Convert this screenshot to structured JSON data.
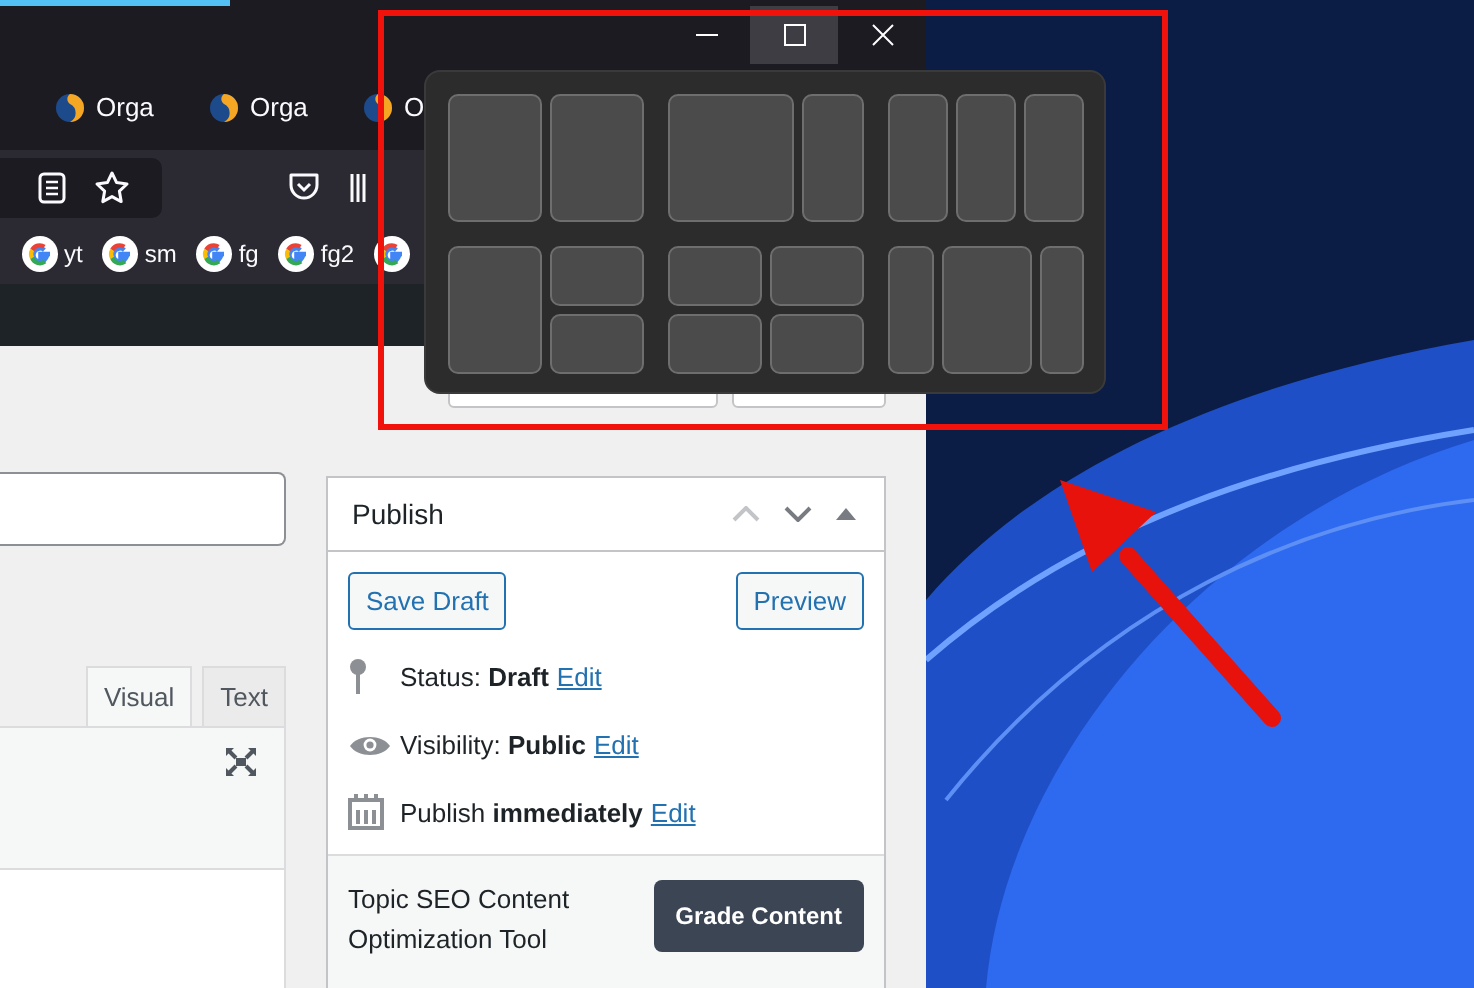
{
  "window_buttons": [
    {
      "kind": "minimize",
      "hovered": false
    },
    {
      "kind": "maximize",
      "hovered": true
    },
    {
      "kind": "close",
      "hovered": false
    }
  ],
  "tabs": [
    {
      "label": "Orga"
    },
    {
      "label": "Orga"
    },
    {
      "label": "O"
    }
  ],
  "bookmarks": [
    {
      "kind": "google",
      "label": "yt"
    },
    {
      "kind": "google",
      "label": "sm"
    },
    {
      "kind": "google",
      "label": "fg"
    },
    {
      "kind": "google",
      "label": "fg2"
    },
    {
      "kind": "google"
    }
  ],
  "editor_tabs": [
    {
      "label": "Visual",
      "selected": true
    },
    {
      "label": "Text",
      "selected": false
    }
  ],
  "publish": {
    "title": "Publish",
    "save_button": "Save Draft",
    "preview_button": "Preview",
    "lines": [
      {
        "kind": "pin",
        "text": "Status: **Draft**",
        "link": "Edit"
      },
      {
        "kind": "eye",
        "text": "Visibility: **Public**",
        "link": "Edit"
      },
      {
        "kind": "calendar",
        "text": "Publish **immediately**",
        "link": "Edit"
      }
    ],
    "tool_label": "Topic SEO Content Optimization Tool",
    "tool_button": "Grade Content"
  },
  "snap_layouts": [
    {
      "kind": "halves"
    },
    {
      "kind": "two-thirds-left"
    },
    {
      "kind": "thirds"
    },
    {
      "kind": "half-and-quarters"
    },
    {
      "kind": "quarters"
    },
    {
      "kind": "wide-center"
    }
  ]
}
